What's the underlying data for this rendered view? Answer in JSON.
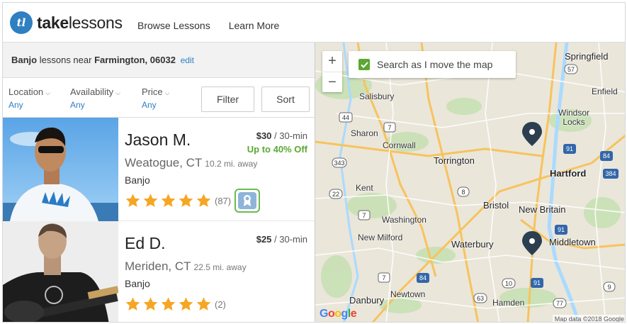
{
  "brand": {
    "logo_mark": "tl",
    "name_bold": "take",
    "name_rest": "lessons"
  },
  "nav": {
    "browse": "Browse Lessons",
    "learn_more": "Learn More"
  },
  "location": {
    "instrument": "Banjo",
    "middle": " lessons near ",
    "place": "Farmington, 06032",
    "edit": "edit"
  },
  "filters": {
    "location": {
      "label": "Location",
      "value": "Any"
    },
    "availability": {
      "label": "Availability",
      "value": "Any"
    },
    "price": {
      "label": "Price",
      "value": "Any"
    },
    "filter_button": "Filter",
    "sort_button": "Sort"
  },
  "teachers": [
    {
      "name": "Jason M.",
      "city": "Weatogue, CT",
      "distance": "10.2 mi. away",
      "instrument": "Banjo",
      "price": "$30",
      "per": " / 30-min",
      "promo": "Up to 40% Off",
      "review_count": "(87)",
      "rating": 5
    },
    {
      "name": "Ed D.",
      "city": "Meriden, CT",
      "distance": "22.5 mi. away",
      "instrument": "Banjo",
      "price": "$25",
      "per": " / 30-min",
      "promo": "",
      "review_count": "(2)",
      "rating": 5
    }
  ],
  "map": {
    "zoom_in": "+",
    "zoom_out": "−",
    "search_as_move": "Search as I move the map",
    "google": "Google",
    "attribution": "Map data ©2018 Google",
    "places": {
      "springfield": "Springfield",
      "enfield": "Enfield",
      "windsor_locks": "Windsor\nLocks",
      "salisbury": "Salisbury",
      "sharon": "Sharon",
      "cornwall": "Cornwall",
      "torrington": "Torrington",
      "hartford": "Hartford",
      "kent": "Kent",
      "bristol": "Bristol",
      "new_britain": "New Britain",
      "washington": "Washington",
      "new_milford": "New Milford",
      "waterbury": "Waterbury",
      "middletown": "Middletown",
      "danbury": "Danbury",
      "newtown": "Newtown",
      "hamden": "Hamden"
    },
    "route_shields": [
      "57",
      "44",
      "7",
      "343",
      "8",
      "22",
      "7",
      "7",
      "84",
      "91",
      "84",
      "384",
      "91",
      "91",
      "10",
      "63",
      "9",
      "77"
    ]
  },
  "colors": {
    "accent_blue": "#2f7fc1",
    "green": "#5aa832",
    "star": "#f6a623",
    "map_bg": "#eae6da",
    "pin": "#2c3e50"
  }
}
